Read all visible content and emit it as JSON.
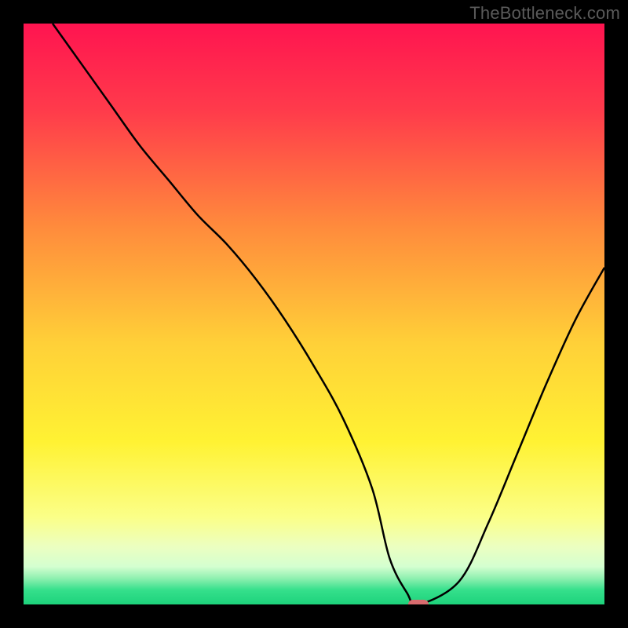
{
  "watermark": "TheBottleneck.com",
  "chart_data": {
    "type": "line",
    "title": "",
    "xlabel": "",
    "ylabel": "",
    "xlim": [
      0,
      100
    ],
    "ylim": [
      0,
      100
    ],
    "x": [
      5,
      10,
      15,
      20,
      25,
      30,
      35,
      40,
      45,
      50,
      55,
      60,
      63,
      66,
      68,
      75,
      80,
      85,
      90,
      95,
      100
    ],
    "values": [
      100,
      93,
      86,
      79,
      73,
      67,
      62,
      56,
      49,
      41,
      32,
      20,
      8,
      2,
      0,
      4,
      14,
      26,
      38,
      49,
      58
    ],
    "marker": {
      "x": 68,
      "y": 0
    },
    "gradient_stops": [
      {
        "pos": 0.0,
        "color": "#ff1450"
      },
      {
        "pos": 0.15,
        "color": "#ff3b4b"
      },
      {
        "pos": 0.35,
        "color": "#ff8b3c"
      },
      {
        "pos": 0.55,
        "color": "#ffd038"
      },
      {
        "pos": 0.72,
        "color": "#fff233"
      },
      {
        "pos": 0.85,
        "color": "#fbff88"
      },
      {
        "pos": 0.9,
        "color": "#ecffc0"
      },
      {
        "pos": 0.935,
        "color": "#d4ffd0"
      },
      {
        "pos": 0.955,
        "color": "#8ff0b0"
      },
      {
        "pos": 0.975,
        "color": "#35e08c"
      },
      {
        "pos": 1.0,
        "color": "#1dd27b"
      }
    ]
  }
}
